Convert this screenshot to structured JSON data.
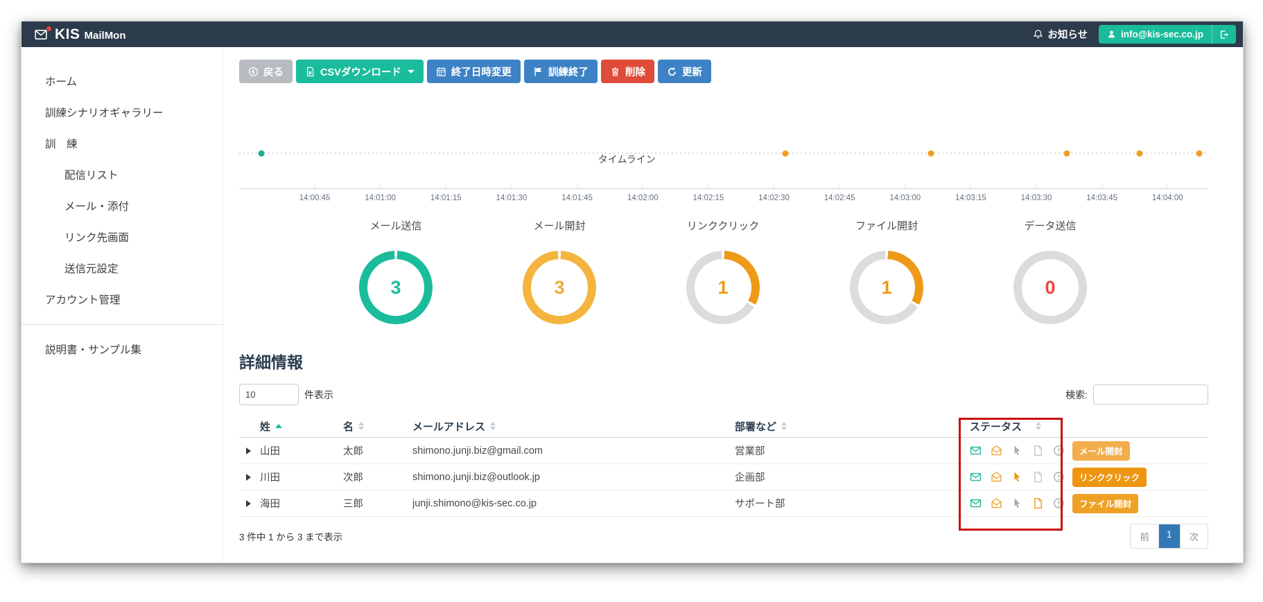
{
  "navbar": {
    "brand_kis": "KIS",
    "brand_mailmon": "MailMon",
    "notice_label": "お知らせ",
    "account_email": "info@kis-sec.co.jp"
  },
  "sidebar": {
    "items": [
      {
        "label": "ホーム",
        "indent": 0
      },
      {
        "label": "訓練シナリオギャラリー",
        "indent": 0
      },
      {
        "label": "訓　練",
        "indent": 0
      },
      {
        "label": "配信リスト",
        "indent": 1
      },
      {
        "label": "メール・添付",
        "indent": 1
      },
      {
        "label": "リンク先画面",
        "indent": 1
      },
      {
        "label": "送信元設定",
        "indent": 1
      },
      {
        "label": "アカウント管理",
        "indent": 0
      }
    ],
    "bottom_items": [
      {
        "label": "説明書・サンプル集",
        "indent": 0
      }
    ]
  },
  "toolbar": {
    "buttons": [
      {
        "label": "戻る",
        "icon": "arrow-left-circle",
        "color": "#b8bcc0",
        "caret": false
      },
      {
        "label": "CSVダウンロード",
        "icon": "file-csv",
        "color": "#1abc9c",
        "caret": true
      },
      {
        "label": "終了日時変更",
        "icon": "calendar",
        "color": "#3c82c4",
        "caret": false
      },
      {
        "label": "訓練終了",
        "icon": "flag",
        "color": "#3c82c4",
        "caret": false
      },
      {
        "label": "削除",
        "icon": "trash",
        "color": "#df4c3a",
        "caret": false
      },
      {
        "label": "更新",
        "icon": "refresh",
        "color": "#3c82c4",
        "caret": false
      }
    ]
  },
  "chart_data": [
    {
      "type": "scatter",
      "title": "タイムライン",
      "xlabel_ticks": [
        "14:00:45",
        "14:01:00",
        "14:01:15",
        "14:01:30",
        "14:01:45",
        "14:02:00",
        "14:02:15",
        "14:02:30",
        "14:02:45",
        "14:03:00",
        "14:03:15",
        "14:03:30",
        "14:03:45",
        "14:04:00"
      ],
      "tick_first_pct": 7.8,
      "tick_last_pct": 95.8,
      "dots": [
        {
          "pos_pct": 2.3,
          "color": "#1fac92",
          "approx_time": "14:00:33"
        },
        {
          "pos_pct": 56.4,
          "color": "#f09e21",
          "approx_time": "14:02:33"
        },
        {
          "pos_pct": 71.4,
          "color": "#f09e21",
          "approx_time": "14:03:06"
        },
        {
          "pos_pct": 85.4,
          "color": "#f09e21",
          "approx_time": "14:03:37"
        },
        {
          "pos_pct": 92.9,
          "color": "#f09e21",
          "approx_time": "14:03:53"
        },
        {
          "pos_pct": 99.1,
          "color": "#f09e21",
          "approx_time": "14:04:07"
        }
      ]
    },
    {
      "type": "donut-set",
      "donuts": [
        {
          "title": "メール送信",
          "value": "3",
          "total": 3,
          "filled": 3,
          "ring_color": "#1bbc9b",
          "value_color": "#1bbc9b"
        },
        {
          "title": "メール開封",
          "value": "3",
          "total": 3,
          "filled": 3,
          "ring_color": "#f5b43e",
          "value_color": "#f0ab38"
        },
        {
          "title": "リンククリック",
          "value": "1",
          "total": 3,
          "filled": 1,
          "ring_color": "#ee9a18",
          "value_color": "#ee9a18"
        },
        {
          "title": "ファイル開封",
          "value": "1",
          "total": 3,
          "filled": 1,
          "ring_color": "#ee9a18",
          "value_color": "#ee9a18"
        },
        {
          "title": "データ送信",
          "value": "0",
          "total": 3,
          "filled": 0,
          "ring_color": "#dcdcdc",
          "value_color": "#e8483f"
        }
      ],
      "rest_color": "#dcdcdc"
    }
  ],
  "details": {
    "heading": "詳細情報",
    "length_value": "10",
    "length_label": "件表示",
    "search_label": "検索:",
    "annotation_color": "#c90b0b",
    "table": {
      "columns": [
        {
          "label": "姓",
          "sort": "asc",
          "cls": "c1"
        },
        {
          "label": "名",
          "sort": "both",
          "cls": "c2"
        },
        {
          "label": "メールアドレス",
          "sort": "both",
          "cls": "c3"
        },
        {
          "label": "部署など",
          "sort": "both",
          "cls": "c4"
        },
        {
          "label": "ステータス",
          "sort": "both",
          "cls": "c5"
        }
      ],
      "rows": [
        {
          "last": "山田",
          "first": "太郎",
          "email": "shimono.junji.biz@gmail.com",
          "dept": "営業部",
          "icons": [
            {
              "name": "mail",
              "color": "#2ab99b"
            },
            {
              "name": "mail-open",
              "color": "#f0a840"
            },
            {
              "name": "cursor",
              "color": "#aaaeb3"
            },
            {
              "name": "file",
              "color": "#c9c9c9"
            },
            {
              "name": "alert",
              "color": "#b3b3b3"
            }
          ],
          "badge": {
            "label": "メール開封",
            "color": "#f3ad4d"
          }
        },
        {
          "last": "川田",
          "first": "次郎",
          "email": "shimono.junji.biz@outlook.jp",
          "dept": "企画部",
          "icons": [
            {
              "name": "mail",
              "color": "#2ab99b"
            },
            {
              "name": "mail-open",
              "color": "#f0a840"
            },
            {
              "name": "cursor",
              "color": "#ee9612"
            },
            {
              "name": "file",
              "color": "#c9c9c9"
            },
            {
              "name": "alert",
              "color": "#b3b3b3"
            }
          ],
          "badge": {
            "label": "リンククリック",
            "color": "#ee9612"
          }
        },
        {
          "last": "海田",
          "first": "三郎",
          "email": "junji.shimono@kis-sec.co.jp",
          "dept": "サポート部",
          "icons": [
            {
              "name": "mail",
              "color": "#2ab99b"
            },
            {
              "name": "mail-open",
              "color": "#f0a840"
            },
            {
              "name": "cursor",
              "color": "#aaaeb3"
            },
            {
              "name": "file",
              "color": "#efa125"
            },
            {
              "name": "alert",
              "color": "#b3b3b3"
            }
          ],
          "badge": {
            "label": "ファイル開封",
            "color": "#efa126"
          }
        }
      ]
    },
    "footer_info": "3 件中 1 から 3 まで表示",
    "pagination": {
      "prev": "前",
      "page": "1",
      "next": "次"
    }
  }
}
